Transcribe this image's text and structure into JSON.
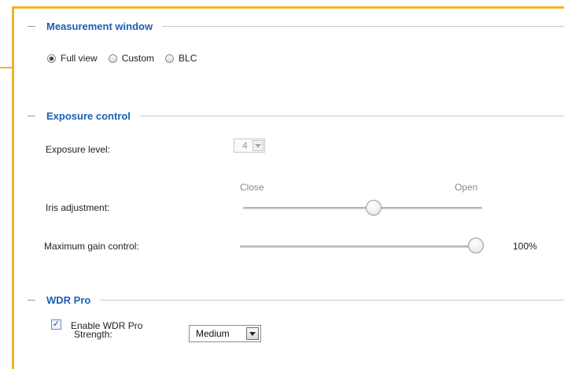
{
  "measurement": {
    "title": "Measurement window",
    "options": [
      "Full view",
      "Custom",
      "BLC"
    ],
    "selected": "Full view"
  },
  "exposure": {
    "title": "Exposure control",
    "level_label": "Exposure level:",
    "level_value": "4",
    "iris_label": "Iris adjustment:",
    "iris_close": "Close",
    "iris_open": "Open",
    "iris_position": 0.55,
    "gain_label": "Maximum gain control:",
    "gain_value": "100%",
    "gain_position": 1.0
  },
  "wdr": {
    "title": "WDR Pro",
    "enable_label": "Enable WDR Pro",
    "enabled": true,
    "check_mark": "✓",
    "strength_label": "Strength:",
    "strength_value": "Medium"
  },
  "colors": {
    "frame": "#f0b429",
    "section_title": "#1c5fb5"
  }
}
